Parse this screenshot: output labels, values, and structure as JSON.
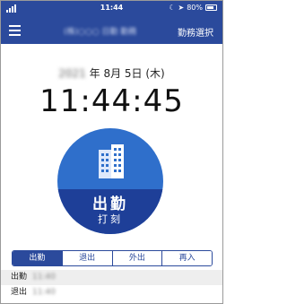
{
  "status_bar": {
    "time": "11:44",
    "battery": "80%",
    "battery_level": 0.8
  },
  "header": {
    "company": "(株)○○○ 日勤 勤務",
    "action_label": "勤務選択"
  },
  "date": {
    "year": "2021",
    "rest": " 年 8月 5日 (木)"
  },
  "clock": "11:44:45",
  "punch_button": {
    "label": "出勤",
    "sublabel": "打刻"
  },
  "tabs": [
    {
      "label": "出勤",
      "active": true
    },
    {
      "label": "退出",
      "active": false
    },
    {
      "label": "外出",
      "active": false
    },
    {
      "label": "再入",
      "active": false
    }
  ],
  "records": [
    {
      "label": "出勤",
      "value": "11:40"
    },
    {
      "label": "退出",
      "value": "11:40"
    }
  ],
  "colors": {
    "brand_blue": "#2b4a9c",
    "button_blue": "#2f6fcb",
    "button_dark_blue": "#1e3f98"
  }
}
